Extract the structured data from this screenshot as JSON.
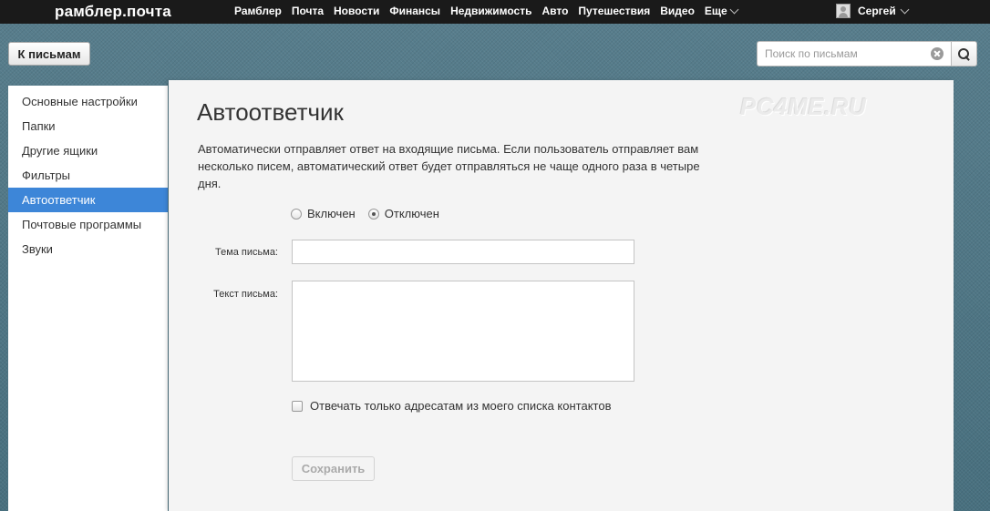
{
  "header": {
    "logo": "рамблер.почта",
    "nav": [
      {
        "label": "Рамблер"
      },
      {
        "label": "Почта"
      },
      {
        "label": "Новости"
      },
      {
        "label": "Финансы"
      },
      {
        "label": "Недвижимость"
      },
      {
        "label": "Авто"
      },
      {
        "label": "Путешествия"
      },
      {
        "label": "Видео"
      },
      {
        "label": "Еще"
      }
    ],
    "user_name": "Сергей"
  },
  "toolbar": {
    "back_label": "К письмам",
    "search_placeholder": "Поиск по письмам",
    "search_value": ""
  },
  "sidebar": {
    "items": [
      {
        "label": "Основные настройки"
      },
      {
        "label": "Папки"
      },
      {
        "label": "Другие ящики"
      },
      {
        "label": "Фильтры"
      },
      {
        "label": "Автоответчик",
        "active": true
      },
      {
        "label": "Почтовые программы"
      },
      {
        "label": "Звуки"
      }
    ]
  },
  "main": {
    "title": "Автоответчик",
    "watermark": "PC4ME.RU",
    "description": "Автоматически отправляет ответ на входящие письма. Если пользователь отправляет вам несколько писем, автоматический ответ будет отправляться не чаще одного раза в четыре дня.",
    "radio_on": "Включен",
    "radio_off": "Отключен",
    "selected": "off",
    "subject_label": "Тема письма:",
    "subject_value": "",
    "body_label": "Текст письма:",
    "body_value": "",
    "contacts_only_label": "Отвечать только адресатам из моего списка контактов",
    "contacts_only_checked": false,
    "save_label": "Сохранить"
  },
  "colors": {
    "topbar": "#1a1a1a",
    "accent": "#3d86d8",
    "background": "#4d7483",
    "panel": "#f4f4f4"
  }
}
